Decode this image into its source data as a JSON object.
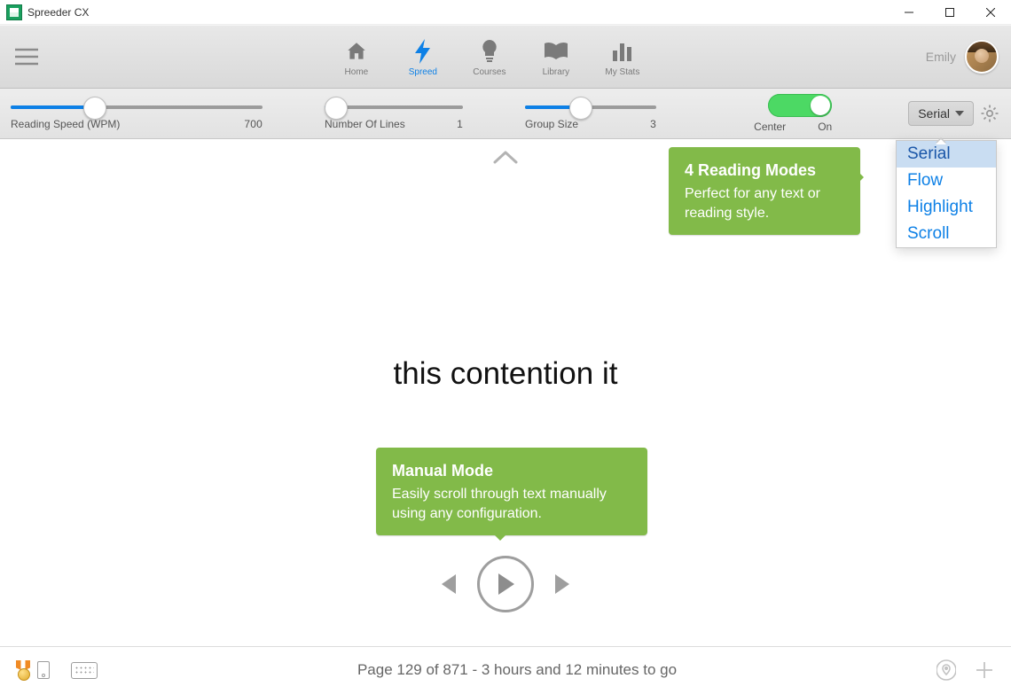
{
  "window": {
    "title": "Spreeder CX"
  },
  "nav": {
    "items": [
      {
        "label": "Home",
        "icon": "home-icon"
      },
      {
        "label": "Spreed",
        "icon": "bolt-icon",
        "active": true
      },
      {
        "label": "Courses",
        "icon": "bulb-icon"
      },
      {
        "label": "Library",
        "icon": "book-icon"
      },
      {
        "label": "My Stats",
        "icon": "bars-icon"
      }
    ]
  },
  "user": {
    "name": "Emily"
  },
  "controls": {
    "speed": {
      "label": "Reading Speed (WPM)",
      "value": "700",
      "fill_pct": 33
    },
    "lines": {
      "label": "Number Of Lines",
      "value": "1",
      "fill_pct": 8
    },
    "group": {
      "label": "Group Size",
      "value": "3",
      "fill_pct": 42
    },
    "center": {
      "label": "Center",
      "state": "On"
    },
    "mode_selected": "Serial"
  },
  "mode_dropdown": {
    "options": [
      "Serial",
      "Flow",
      "Highlight",
      "Scroll"
    ],
    "selected_index": 0
  },
  "callouts": {
    "modes": {
      "title": "4 Reading Modes",
      "body": "Perfect for any text or reading style."
    },
    "manual": {
      "title": "Manual Mode",
      "body": "Easily scroll through text manually using any configuration."
    }
  },
  "reading": {
    "text": "this contention it"
  },
  "status": {
    "text": "Page 129 of 871 - 3 hours and 12 minutes to go"
  },
  "colors": {
    "accent": "#0d80e6",
    "callout": "#82ba49",
    "switch": "#4cd964"
  }
}
